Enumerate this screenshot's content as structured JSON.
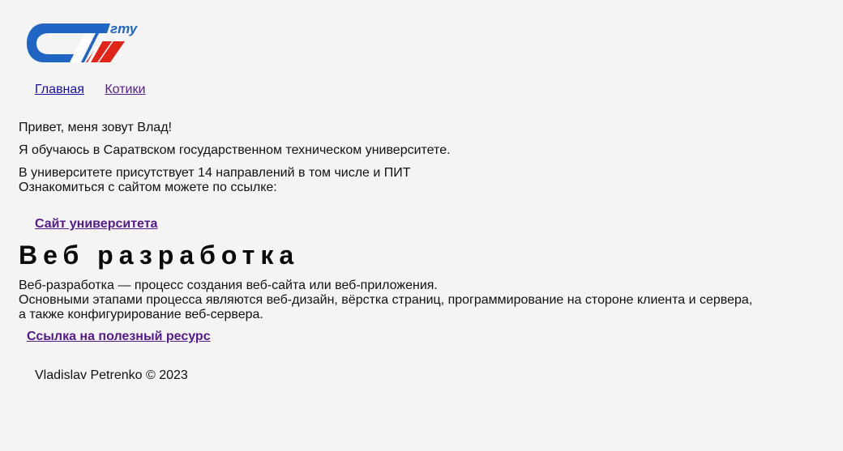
{
  "logo": {
    "text": "гту",
    "colors": {
      "blue": "#1f66c4",
      "red": "#e2231a"
    }
  },
  "nav": {
    "items": [
      {
        "label": "Главная"
      },
      {
        "label": "Котики"
      }
    ]
  },
  "intro": {
    "greeting": "Привет, меня зовут Влад!",
    "study": "Я обучаюсь в Саратвском государственном техническом университете.",
    "directions": "В университете присутствует 14 направлений в том числе и ПИТ",
    "site_hint": "Ознакомиться с сайтом можете по ссылке:",
    "university_link": "Сайт университета"
  },
  "section": {
    "title": "Веб разработка",
    "line1": "Веб-разработка — процесс создания веб-сайта или веб-приложения.",
    "line2": "Основными этапами процесса являются веб-дизайн, вёрстка страниц, программирование на стороне клиента и сервера,",
    "line3": "а также конфигурирование веб-сервера.",
    "resource_link": "Ссылка на полезный ресурс"
  },
  "footer": {
    "text": "Vladislav Petrenko © 2023"
  },
  "colors": {
    "background": "#f4f4f4",
    "link": "#1a0dab",
    "visited_link": "#551a8b"
  }
}
